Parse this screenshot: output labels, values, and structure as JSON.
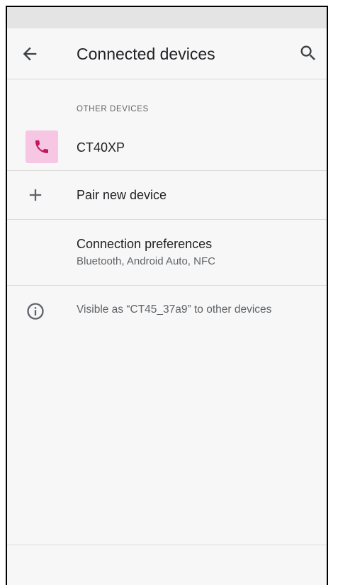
{
  "app_bar": {
    "title": "Connected devices",
    "back_icon": "arrow-back-icon",
    "search_icon": "search-icon"
  },
  "other_devices": {
    "header": "OTHER DEVICES",
    "devices": [
      {
        "name": "CT40XP",
        "icon": "phone-icon",
        "icon_bg": "#f6c6e3",
        "icon_color": "#c2185b"
      }
    ]
  },
  "pair": {
    "label": "Pair new device",
    "icon": "add-icon"
  },
  "preferences": {
    "label": "Connection preferences",
    "summary": "Bluetooth, Android Auto, NFC"
  },
  "footer_info": {
    "text": "Visible as “CT45_37a9” to other devices",
    "icon": "info-icon"
  },
  "colors": {
    "background": "#f7f7f7",
    "status_bar": "#e4e4e4",
    "primary_text": "#202124",
    "secondary_text": "#5f6368",
    "divider": "#dcdcdc"
  }
}
